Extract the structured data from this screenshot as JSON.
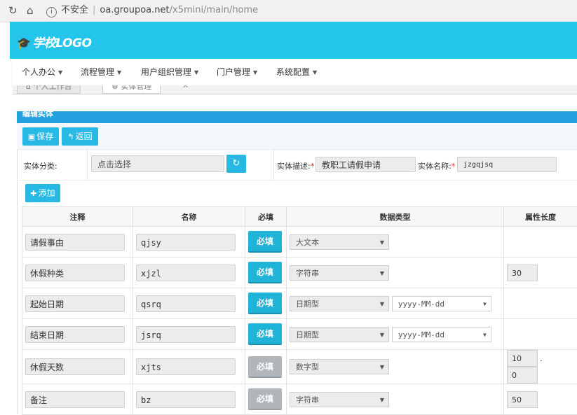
{
  "browser": {
    "security_label": "不安全",
    "url_host": "oa.groupoa.net",
    "url_path": "/x5mini/main/home"
  },
  "header": {
    "logo_text": "学校LOGO",
    "bg_color": "#23c6ea"
  },
  "menu": [
    {
      "label": "个人办公"
    },
    {
      "label": "流程管理"
    },
    {
      "label": "用户组织管理"
    },
    {
      "label": "门户管理"
    },
    {
      "label": "系统配置"
    }
  ],
  "tabs": [
    {
      "label": "个人工作台"
    },
    {
      "label": "实体管理"
    }
  ],
  "panel": {
    "title": "编辑实体"
  },
  "toolbar": {
    "save_label": "保存",
    "back_label": "返回"
  },
  "form": {
    "category_label": "实体分类:",
    "category_placeholder": "点击选择",
    "desc_label": "实体描述:",
    "desc_value": "教职工请假申请",
    "name_label": "实体名称:",
    "name_value": "jzgqjsq",
    "required_mark": "*"
  },
  "add_label": "添加",
  "grid": {
    "headers": [
      "注释",
      "名称",
      "必填",
      "数据类型",
      "属性长度"
    ],
    "rows": [
      {
        "comment": "请假事由",
        "name": "qjsy",
        "required_label": "必填",
        "required_on": true,
        "type": "大文本",
        "format": "",
        "length": "",
        "decimal": ""
      },
      {
        "comment": "休假种类",
        "name": "xjzl",
        "required_label": "必填",
        "required_on": true,
        "type": "字符串",
        "format": "",
        "length": "30",
        "decimal": ""
      },
      {
        "comment": "起始日期",
        "name": "qsrq",
        "required_label": "必填",
        "required_on": true,
        "type": "日期型",
        "format": "yyyy-MM-dd",
        "length": "",
        "decimal": ""
      },
      {
        "comment": "结束日期",
        "name": "jsrq",
        "required_label": "必填",
        "required_on": true,
        "type": "日期型",
        "format": "yyyy-MM-dd",
        "length": "",
        "decimal": ""
      },
      {
        "comment": "休假天数",
        "name": "xjts",
        "required_label": "必填",
        "required_on": false,
        "type": "数字型",
        "format": "",
        "length": "10",
        "decimal": "0"
      },
      {
        "comment": "备注",
        "name": "bz",
        "required_label": "必填",
        "required_on": false,
        "type": "字符串",
        "format": "",
        "length": "50",
        "decimal": ""
      }
    ]
  }
}
